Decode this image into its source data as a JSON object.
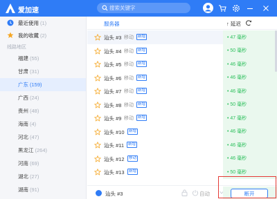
{
  "app": {
    "name": "爱加速"
  },
  "search": {
    "placeholder": "搜索关键字"
  },
  "sidebar": {
    "recent": {
      "label": "最近使用",
      "count": "(1)"
    },
    "favorites": {
      "label": "我的收藏",
      "count": "(2)"
    },
    "section_label": "线路地区",
    "regions": [
      {
        "name": "福建",
        "count": "(55)",
        "active": false
      },
      {
        "name": "甘肃",
        "count": "(31)",
        "active": false
      },
      {
        "name": "广东",
        "count": "(159)",
        "active": true
      },
      {
        "name": "广西",
        "count": "(24)",
        "active": false
      },
      {
        "name": "贵州",
        "count": "(48)",
        "active": false
      },
      {
        "name": "海南",
        "count": "(4)",
        "active": false
      },
      {
        "name": "河北",
        "count": "(47)",
        "active": false
      },
      {
        "name": "黑龙江",
        "count": "(264)",
        "active": false
      },
      {
        "name": "河南",
        "count": "(69)",
        "active": false
      },
      {
        "name": "湖北",
        "count": "(27)",
        "active": false
      },
      {
        "name": "湖南",
        "count": "(91)",
        "active": false
      }
    ]
  },
  "list": {
    "header_server": "服务器",
    "header_latency": "↑ 延迟",
    "rows": [
      {
        "name": "汕头 #3",
        "isp": "移动",
        "badge": "新增",
        "latency": "• 47 毫秒"
      },
      {
        "name": "汕头 #4",
        "isp": "移动",
        "badge": "新增",
        "latency": "• 50 毫秒"
      },
      {
        "name": "汕头 #5",
        "isp": "移动",
        "badge": "新增",
        "latency": "• 46 毫秒"
      },
      {
        "name": "汕头 #6",
        "isp": "移动",
        "badge": "新增",
        "latency": "• 46 毫秒"
      },
      {
        "name": "汕头 #7",
        "isp": "移动",
        "badge": "新增",
        "latency": "• 46 毫秒"
      },
      {
        "name": "汕头 #8",
        "isp": "移动",
        "badge": "新增",
        "latency": "• 50 毫秒"
      },
      {
        "name": "汕头 #9",
        "isp": "移动",
        "badge": "新增",
        "latency": "• 47 毫秒"
      },
      {
        "name": "汕头 #10",
        "isp": "",
        "badge": "新增",
        "latency": "• 46 毫秒"
      },
      {
        "name": "汕头 #11",
        "isp": "",
        "badge": "新增",
        "latency": "• 46 毫秒"
      },
      {
        "name": "汕头 #12",
        "isp": "",
        "badge": "移动",
        "latency": "• 46 毫秒"
      },
      {
        "name": "汕头 #13",
        "isp": "",
        "badge": "新增",
        "latency": "• 50 毫秒"
      }
    ]
  },
  "bottom": {
    "current_server": "汕头 #3",
    "auto_label": "自动",
    "disconnect_label": "断开"
  },
  "colors": {
    "brand": "#2f7cf6",
    "latency_green": "#2bbf5b",
    "highlight_red": "#e53935"
  }
}
